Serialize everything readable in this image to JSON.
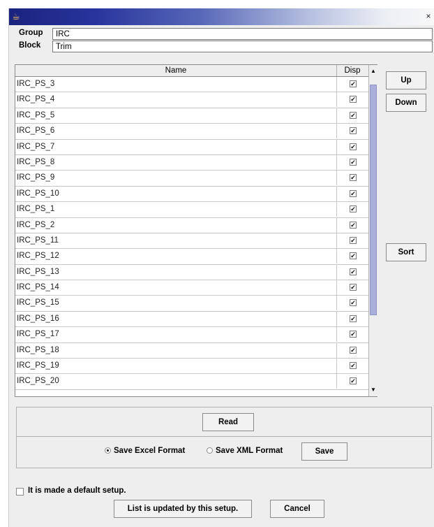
{
  "window": {
    "icon": "java-cup-icon",
    "close_glyph": "×"
  },
  "fields": {
    "group": {
      "label": "Group",
      "value": "IRC"
    },
    "block": {
      "label": "Block",
      "value": "Trim"
    }
  },
  "table": {
    "columns": [
      "Name",
      "Disp"
    ],
    "rows": [
      {
        "name": "IRC_PS_3",
        "disp": true
      },
      {
        "name": "IRC_PS_4",
        "disp": true
      },
      {
        "name": "IRC_PS_5",
        "disp": true
      },
      {
        "name": "IRC_PS_6",
        "disp": true
      },
      {
        "name": "IRC_PS_7",
        "disp": true
      },
      {
        "name": "IRC_PS_8",
        "disp": true
      },
      {
        "name": "IRC_PS_9",
        "disp": true
      },
      {
        "name": "IRC_PS_10",
        "disp": true
      },
      {
        "name": "IRC_PS_1",
        "disp": true
      },
      {
        "name": "IRC_PS_2",
        "disp": true
      },
      {
        "name": "IRC_PS_11",
        "disp": true
      },
      {
        "name": "IRC_PS_12",
        "disp": true
      },
      {
        "name": "IRC_PS_13",
        "disp": true
      },
      {
        "name": "IRC_PS_14",
        "disp": true
      },
      {
        "name": "IRC_PS_15",
        "disp": true
      },
      {
        "name": "IRC_PS_16",
        "disp": true
      },
      {
        "name": "IRC_PS_17",
        "disp": true
      },
      {
        "name": "IRC_PS_18",
        "disp": true
      },
      {
        "name": "IRC_PS_19",
        "disp": true
      },
      {
        "name": "IRC_PS_20",
        "disp": true
      }
    ],
    "check_glyph": "✔"
  },
  "side_buttons": {
    "up": "Up",
    "down": "Down",
    "sort": "Sort"
  },
  "bottom": {
    "read": "Read",
    "excel_format": "Save Excel Format",
    "xml_format": "Save XML Format",
    "save": "Save",
    "selected_format": "excel"
  },
  "default_setup": {
    "label": "It is made a default setup.",
    "checked": false
  },
  "footer": {
    "apply": "List is updated by this setup.",
    "cancel": "Cancel"
  },
  "colors": {
    "title_gradient_start": "#1a237e",
    "title_gradient_end": "#f8f8f8",
    "scroll_thumb": "#a9aeda",
    "dialog_bg": "#eeeeee"
  }
}
